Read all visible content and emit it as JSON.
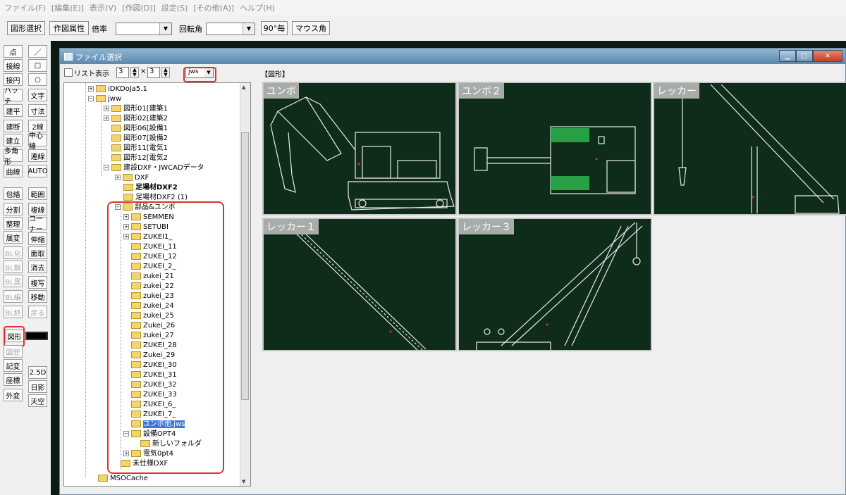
{
  "menu": [
    "ファイル(F)",
    "[編集(E)]",
    "表示(V)",
    "[作図(D)]",
    "設定(S)",
    "[その他(A)]",
    "ヘルプ(H)"
  ],
  "toolbar": {
    "select_shape": "図形選択",
    "draw_attr": "作図属性",
    "scale_label": "倍率",
    "rotate_label": "回転角",
    "deg90": "90°毎",
    "mouse_angle": "マウス角"
  },
  "left_tools": [
    [
      "点",
      "／"
    ],
    [
      "接線",
      "□"
    ],
    [
      "接円",
      "○"
    ],
    [
      "ハッチ",
      "文字"
    ],
    [
      "建平",
      "寸法"
    ],
    [
      "建断",
      "2線"
    ],
    [
      "建立",
      "中心線"
    ],
    [
      "多角形",
      "連線"
    ],
    [
      "曲線",
      "AUTO"
    ],
    [
      "包絡",
      "範囲"
    ],
    [
      "分割",
      "複線"
    ],
    [
      "整理",
      "コーナー"
    ],
    [
      "属変",
      "伸縮"
    ],
    [
      "BL化",
      "面取"
    ],
    [
      "BL解",
      "消去"
    ],
    [
      "BL属",
      "複写"
    ],
    [
      "BL編",
      "移動"
    ],
    [
      "BL終",
      "戻る"
    ],
    [
      "図形",
      ""
    ],
    [
      "図登",
      ""
    ],
    [
      "記変",
      "2.5D"
    ],
    [
      "座標",
      "日影"
    ],
    [
      "外変",
      "天空"
    ]
  ],
  "dialog": {
    "title": "ファイル選択",
    "list_view_label": "リスト表示",
    "cols": "3",
    "times": "×",
    "rows": "3",
    "filter": "jws",
    "preview_header": "【図形】"
  },
  "tree": {
    "items": [
      "iDKDoJa5.1",
      "jww",
      "図形01[建築1",
      "図形02[建築2",
      "図形06[設備1",
      "図形07[設備2",
      "図形11[電気1",
      "図形12[電気2",
      "建設DXF・JWCADデータ",
      "DXF",
      "足場材DXF2",
      "足場材DXF2 (1)",
      "部品&ユンボ",
      "SEMMEN",
      "SETUBI",
      "ZUKEI1_",
      "ZUKEI_11",
      "ZUKEI_12",
      "ZUKEI_2_",
      "zukei_21",
      "zukei_22",
      "zukei_23",
      "zukei_24",
      "zukei_25",
      "Zukei_26",
      "zukei_27",
      "ZUKEI_28",
      "Zukei_29",
      "ZUKEI_30",
      "ZUKEI_31",
      "ZUKEI_32",
      "ZUKEI_33",
      "ZUKEI_6_",
      "ZUKEI_7_",
      "ユンボ他.jws",
      "設備OPT4",
      "新しいフォルダ",
      "電気0pt4",
      "未仕様DXF",
      "MSOCache"
    ]
  },
  "previews": [
    {
      "label": "ユンボ"
    },
    {
      "label": "ユンボ２"
    },
    {
      "label": "レッカー"
    },
    {
      "label": "レッカー１"
    },
    {
      "label": "レッカー３"
    }
  ],
  "colors": {
    "cad_bg": "#0f2c1a",
    "highlight": "#d9342b",
    "selection": "#3a76d6"
  }
}
